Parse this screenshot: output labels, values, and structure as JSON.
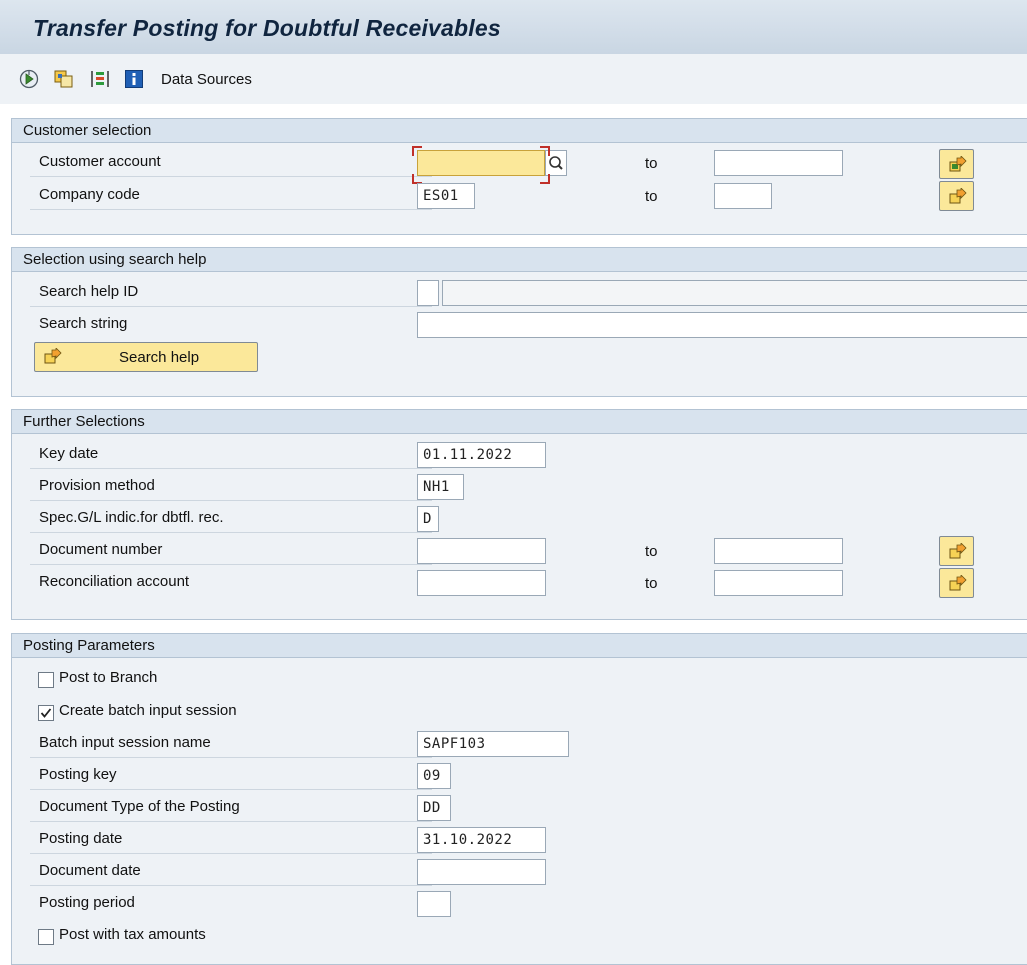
{
  "title": "Transfer Posting for Doubtful Receivables",
  "toolbar": {
    "icons": [
      "execute-icon",
      "copy-variant-icon",
      "selection-options-icon",
      "info-icon"
    ],
    "data_sources_label": "Data Sources"
  },
  "customer_selection": {
    "header": "Customer selection",
    "rows": [
      {
        "label": "Customer account",
        "from": "",
        "to_label": "to",
        "to": ""
      },
      {
        "label": "Company code",
        "from": "ES01",
        "to_label": "to",
        "to": ""
      }
    ]
  },
  "search_help_section": {
    "header": "Selection using search help",
    "search_help_id_label": "Search help ID",
    "search_help_id_value": "",
    "search_help_id_desc": "",
    "search_string_label": "Search string",
    "search_string_value": "",
    "button_label": "Search help"
  },
  "further_selections": {
    "header": "Further Selections",
    "key_date_label": "Key date",
    "key_date": "01.11.2022",
    "provision_method_label": "Provision method",
    "provision_method": "NH1",
    "spec_gl_label": "Spec.G/L indic.for dbtfl. rec.",
    "spec_gl": "D",
    "document_number_label": "Document number",
    "document_number_from": "",
    "document_number_to": "",
    "recon_account_label": "Reconciliation account",
    "recon_account_from": "",
    "recon_account_to": "",
    "to_label": "to"
  },
  "posting_parameters": {
    "header": "Posting Parameters",
    "post_to_branch_label": "Post to Branch",
    "post_to_branch_checked": false,
    "create_batch_label": "Create batch input session",
    "create_batch_checked": true,
    "batch_name_label": "Batch input session name",
    "batch_name": "SAPF103",
    "posting_key_label": "Posting key",
    "posting_key": "09",
    "doc_type_label": "Document Type of the Posting",
    "doc_type": "DD",
    "posting_date_label": "Posting date",
    "posting_date": "31.10.2022",
    "document_date_label": "Document date",
    "document_date": "",
    "posting_period_label": "Posting period",
    "posting_period": "",
    "post_with_tax_label": "Post with tax amounts",
    "post_with_tax_checked": false
  },
  "colors": {
    "required_field": "#fbe89a",
    "button_yellow": "#fbe89a",
    "header_blue": "#d8e3ee",
    "panel": "#eef2f6"
  }
}
